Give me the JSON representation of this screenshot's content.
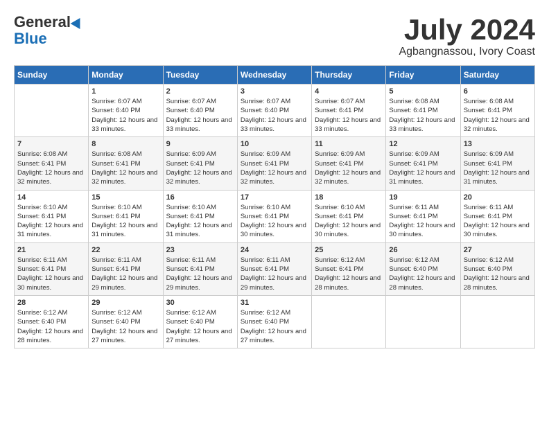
{
  "header": {
    "logo_line1": "General",
    "logo_line2": "Blue",
    "month": "July 2024",
    "location": "Agbangnassou, Ivory Coast"
  },
  "days_of_week": [
    "Sunday",
    "Monday",
    "Tuesday",
    "Wednesday",
    "Thursday",
    "Friday",
    "Saturday"
  ],
  "weeks": [
    [
      {
        "day": "",
        "sunrise": "",
        "sunset": "",
        "daylight": ""
      },
      {
        "day": "1",
        "sunrise": "Sunrise: 6:07 AM",
        "sunset": "Sunset: 6:40 PM",
        "daylight": "Daylight: 12 hours and 33 minutes."
      },
      {
        "day": "2",
        "sunrise": "Sunrise: 6:07 AM",
        "sunset": "Sunset: 6:40 PM",
        "daylight": "Daylight: 12 hours and 33 minutes."
      },
      {
        "day": "3",
        "sunrise": "Sunrise: 6:07 AM",
        "sunset": "Sunset: 6:40 PM",
        "daylight": "Daylight: 12 hours and 33 minutes."
      },
      {
        "day": "4",
        "sunrise": "Sunrise: 6:07 AM",
        "sunset": "Sunset: 6:41 PM",
        "daylight": "Daylight: 12 hours and 33 minutes."
      },
      {
        "day": "5",
        "sunrise": "Sunrise: 6:08 AM",
        "sunset": "Sunset: 6:41 PM",
        "daylight": "Daylight: 12 hours and 33 minutes."
      },
      {
        "day": "6",
        "sunrise": "Sunrise: 6:08 AM",
        "sunset": "Sunset: 6:41 PM",
        "daylight": "Daylight: 12 hours and 32 minutes."
      }
    ],
    [
      {
        "day": "7",
        "sunrise": "Sunrise: 6:08 AM",
        "sunset": "Sunset: 6:41 PM",
        "daylight": "Daylight: 12 hours and 32 minutes."
      },
      {
        "day": "8",
        "sunrise": "Sunrise: 6:08 AM",
        "sunset": "Sunset: 6:41 PM",
        "daylight": "Daylight: 12 hours and 32 minutes."
      },
      {
        "day": "9",
        "sunrise": "Sunrise: 6:09 AM",
        "sunset": "Sunset: 6:41 PM",
        "daylight": "Daylight: 12 hours and 32 minutes."
      },
      {
        "day": "10",
        "sunrise": "Sunrise: 6:09 AM",
        "sunset": "Sunset: 6:41 PM",
        "daylight": "Daylight: 12 hours and 32 minutes."
      },
      {
        "day": "11",
        "sunrise": "Sunrise: 6:09 AM",
        "sunset": "Sunset: 6:41 PM",
        "daylight": "Daylight: 12 hours and 32 minutes."
      },
      {
        "day": "12",
        "sunrise": "Sunrise: 6:09 AM",
        "sunset": "Sunset: 6:41 PM",
        "daylight": "Daylight: 12 hours and 31 minutes."
      },
      {
        "day": "13",
        "sunrise": "Sunrise: 6:09 AM",
        "sunset": "Sunset: 6:41 PM",
        "daylight": "Daylight: 12 hours and 31 minutes."
      }
    ],
    [
      {
        "day": "14",
        "sunrise": "Sunrise: 6:10 AM",
        "sunset": "Sunset: 6:41 PM",
        "daylight": "Daylight: 12 hours and 31 minutes."
      },
      {
        "day": "15",
        "sunrise": "Sunrise: 6:10 AM",
        "sunset": "Sunset: 6:41 PM",
        "daylight": "Daylight: 12 hours and 31 minutes."
      },
      {
        "day": "16",
        "sunrise": "Sunrise: 6:10 AM",
        "sunset": "Sunset: 6:41 PM",
        "daylight": "Daylight: 12 hours and 31 minutes."
      },
      {
        "day": "17",
        "sunrise": "Sunrise: 6:10 AM",
        "sunset": "Sunset: 6:41 PM",
        "daylight": "Daylight: 12 hours and 30 minutes."
      },
      {
        "day": "18",
        "sunrise": "Sunrise: 6:10 AM",
        "sunset": "Sunset: 6:41 PM",
        "daylight": "Daylight: 12 hours and 30 minutes."
      },
      {
        "day": "19",
        "sunrise": "Sunrise: 6:11 AM",
        "sunset": "Sunset: 6:41 PM",
        "daylight": "Daylight: 12 hours and 30 minutes."
      },
      {
        "day": "20",
        "sunrise": "Sunrise: 6:11 AM",
        "sunset": "Sunset: 6:41 PM",
        "daylight": "Daylight: 12 hours and 30 minutes."
      }
    ],
    [
      {
        "day": "21",
        "sunrise": "Sunrise: 6:11 AM",
        "sunset": "Sunset: 6:41 PM",
        "daylight": "Daylight: 12 hours and 30 minutes."
      },
      {
        "day": "22",
        "sunrise": "Sunrise: 6:11 AM",
        "sunset": "Sunset: 6:41 PM",
        "daylight": "Daylight: 12 hours and 29 minutes."
      },
      {
        "day": "23",
        "sunrise": "Sunrise: 6:11 AM",
        "sunset": "Sunset: 6:41 PM",
        "daylight": "Daylight: 12 hours and 29 minutes."
      },
      {
        "day": "24",
        "sunrise": "Sunrise: 6:11 AM",
        "sunset": "Sunset: 6:41 PM",
        "daylight": "Daylight: 12 hours and 29 minutes."
      },
      {
        "day": "25",
        "sunrise": "Sunrise: 6:12 AM",
        "sunset": "Sunset: 6:41 PM",
        "daylight": "Daylight: 12 hours and 28 minutes."
      },
      {
        "day": "26",
        "sunrise": "Sunrise: 6:12 AM",
        "sunset": "Sunset: 6:40 PM",
        "daylight": "Daylight: 12 hours and 28 minutes."
      },
      {
        "day": "27",
        "sunrise": "Sunrise: 6:12 AM",
        "sunset": "Sunset: 6:40 PM",
        "daylight": "Daylight: 12 hours and 28 minutes."
      }
    ],
    [
      {
        "day": "28",
        "sunrise": "Sunrise: 6:12 AM",
        "sunset": "Sunset: 6:40 PM",
        "daylight": "Daylight: 12 hours and 28 minutes."
      },
      {
        "day": "29",
        "sunrise": "Sunrise: 6:12 AM",
        "sunset": "Sunset: 6:40 PM",
        "daylight": "Daylight: 12 hours and 27 minutes."
      },
      {
        "day": "30",
        "sunrise": "Sunrise: 6:12 AM",
        "sunset": "Sunset: 6:40 PM",
        "daylight": "Daylight: 12 hours and 27 minutes."
      },
      {
        "day": "31",
        "sunrise": "Sunrise: 6:12 AM",
        "sunset": "Sunset: 6:40 PM",
        "daylight": "Daylight: 12 hours and 27 minutes."
      },
      {
        "day": "",
        "sunrise": "",
        "sunset": "",
        "daylight": ""
      },
      {
        "day": "",
        "sunrise": "",
        "sunset": "",
        "daylight": ""
      },
      {
        "day": "",
        "sunrise": "",
        "sunset": "",
        "daylight": ""
      }
    ]
  ]
}
